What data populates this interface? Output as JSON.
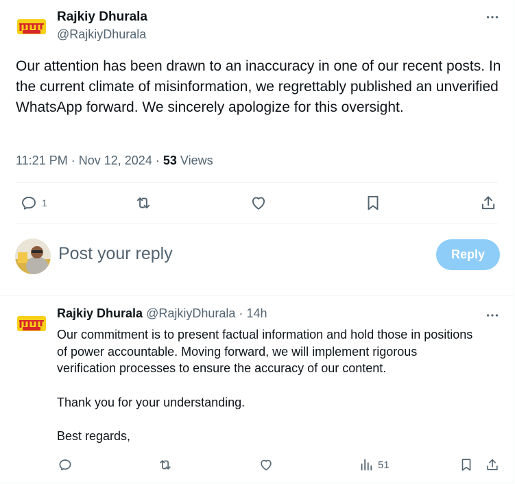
{
  "tweet": {
    "author_name": "Rajkiy Dhurala",
    "author_handle": "@RajkiyDhurala",
    "text": "Our attention has been drawn to an inaccuracy in one of our recent posts. In the current climate of misinformation, we regrettably published an unverified WhatsApp forward. We sincerely apologize for this oversight.",
    "time": "11:21 PM",
    "separator": "·",
    "date": "Nov 12, 2024",
    "views_count": "53",
    "views_label": "Views",
    "reply_count": "1"
  },
  "composer": {
    "placeholder": "Post your reply",
    "reply_label": "Reply"
  },
  "reply": {
    "author_name": "Rajkiy Dhurala",
    "author_handle": "@RajkiyDhurala",
    "separator": "·",
    "age": "14h",
    "paragraphs": [
      "Our commitment is to present factual information and hold those in positions of power accountable. Moving forward, we will implement rigorous verification processes to ensure the accuracy of our content.",
      "Thank you for your understanding.",
      "Best regards,"
    ],
    "views_count": "51"
  },
  "colors": {
    "text_primary": "#0f1419",
    "text_secondary": "#536471",
    "reply_button_bg": "#8ecdf8",
    "divider": "#eff3f4",
    "logo_yellow": "#f7d117",
    "logo_red": "#d7262b"
  },
  "icons": [
    "more-icon",
    "reply-icon",
    "repost-icon",
    "like-icon",
    "bookmark-icon",
    "share-icon",
    "views-icon"
  ]
}
